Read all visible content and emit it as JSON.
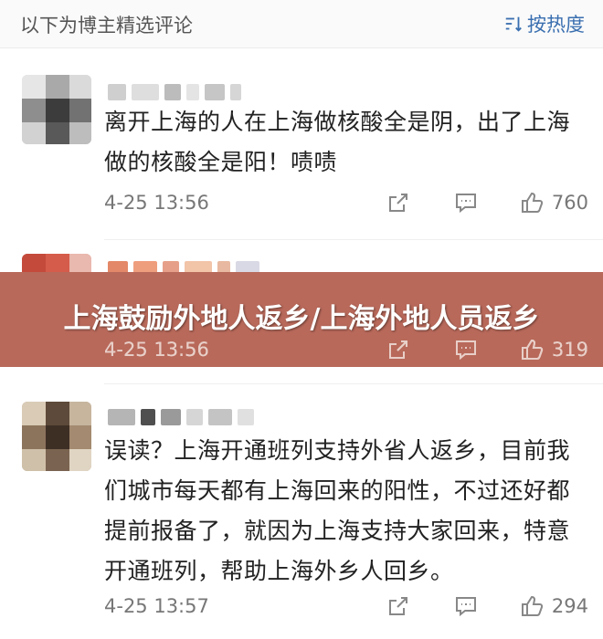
{
  "header": {
    "title": "以下为博主精选评论",
    "sort_label": "按热度"
  },
  "banner": {
    "text": "上海鼓励外地人返乡/上海外地人员返乡"
  },
  "comments": [
    {
      "text": "离开上海的人在上海做核酸全是阴，出了上海做的核酸全是阳！啧啧",
      "time": "4-25 13:56",
      "likes": "760"
    },
    {
      "text": "",
      "time": "4-25 13:56",
      "likes": "319"
    },
    {
      "text": "误读？上海开通班列支持外省人返乡，目前我们城市每天都有上海回来的阳性，不过还好都提前报备了，就因为上海支持大家回来，特意开通班列，帮助上海外乡人回乡。",
      "time": "4-25 13:57",
      "likes": "294"
    }
  ],
  "colors": {
    "banner_bg": "#b8695a",
    "accent": "#3a6fb0"
  }
}
